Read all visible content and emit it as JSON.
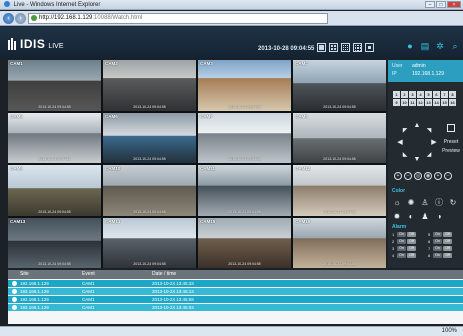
{
  "browser": {
    "window_title": "Live - Windows Internet Explorer",
    "url_host": "http://192.168.1.129",
    "url_path": ":10088/Watch.html",
    "zoom": "100%"
  },
  "app": {
    "logo_text": "IDIS",
    "mode": "LIVE",
    "datetime": "2013-10-28 09:04:55"
  },
  "cameras": [
    {
      "label": "CAM1",
      "ts": "2013-10-24 09:04:55"
    },
    {
      "label": "CAM2",
      "ts": "2013-10-24 09:04:55"
    },
    {
      "label": "CAM3",
      "ts": "2013-10-24 09:04:55"
    },
    {
      "label": "CAM4",
      "ts": "2013-10-24 09:04:55"
    },
    {
      "label": "CAM5",
      "ts": "2013-10-24 09:04:55"
    },
    {
      "label": "CAM6",
      "ts": "2013-10-24 09:04:55"
    },
    {
      "label": "CAM7",
      "ts": "2013-10-24 09:04:55"
    },
    {
      "label": "CAM8",
      "ts": "2013-10-24 09:04:55"
    },
    {
      "label": "CAM9",
      "ts": "2013-10-24 09:04:55"
    },
    {
      "label": "CAM10",
      "ts": "2013-10-24 09:04:55"
    },
    {
      "label": "CAM11",
      "ts": "2013-10-24 09:04:55"
    },
    {
      "label": "CAM12",
      "ts": "2013-10-24 09:04:55"
    },
    {
      "label": "CAM13",
      "ts": "2013-10-24 09:04:55"
    },
    {
      "label": "CAM14",
      "ts": "2013-10-24 09:04:55"
    },
    {
      "label": "CAM15",
      "ts": "2013-10-24 09:04:55"
    },
    {
      "label": "CAM16",
      "ts": "2013-10-24 09:04:55"
    }
  ],
  "panel": {
    "user_label": "User",
    "user_value": "admin",
    "ip_label": "IP",
    "ip_value": "192.168.1.129",
    "channels": [
      "1",
      "2",
      "3",
      "4",
      "5",
      "6",
      "7",
      "8",
      "9",
      "10",
      "11",
      "12",
      "13",
      "14",
      "15",
      "16"
    ],
    "preset_label": "Preset",
    "preview_label": "Preview",
    "color_title": "Color",
    "alarm_title": "Alarm",
    "alarms": [
      {
        "num": "1",
        "on": "On",
        "off": "Off"
      },
      {
        "num": "5",
        "on": "On",
        "off": "Off"
      },
      {
        "num": "2",
        "on": "On",
        "off": "Off"
      },
      {
        "num": "6",
        "on": "On",
        "off": "Off"
      },
      {
        "num": "3",
        "on": "On",
        "off": "Off"
      },
      {
        "num": "7",
        "on": "On",
        "off": "Off"
      },
      {
        "num": "4",
        "on": "On",
        "off": "Off"
      },
      {
        "num": "8",
        "on": "On",
        "off": "Off"
      }
    ]
  },
  "log": {
    "headers": {
      "site": "Site",
      "event": "Event",
      "time": "Date / time"
    },
    "rows": [
      {
        "site": "192.168.1.129",
        "event": "CAM1",
        "time": "2013-10-24 13:45:33"
      },
      {
        "site": "192.168.1.129",
        "event": "CAM1",
        "time": "2013-10-24 13:45:13"
      },
      {
        "site": "192.168.1.129",
        "event": "CAM1",
        "time": "2013-10-24 13:45:58"
      },
      {
        "site": "192.168.1.129",
        "event": "CAM1",
        "time": "2013-10-24 13:45:03"
      }
    ]
  },
  "colors": {
    "accent": "#2c9fc1",
    "log_row": "#1ba7c7",
    "selected_cam": "#4bd34b",
    "header_bg": "#1f3346"
  }
}
